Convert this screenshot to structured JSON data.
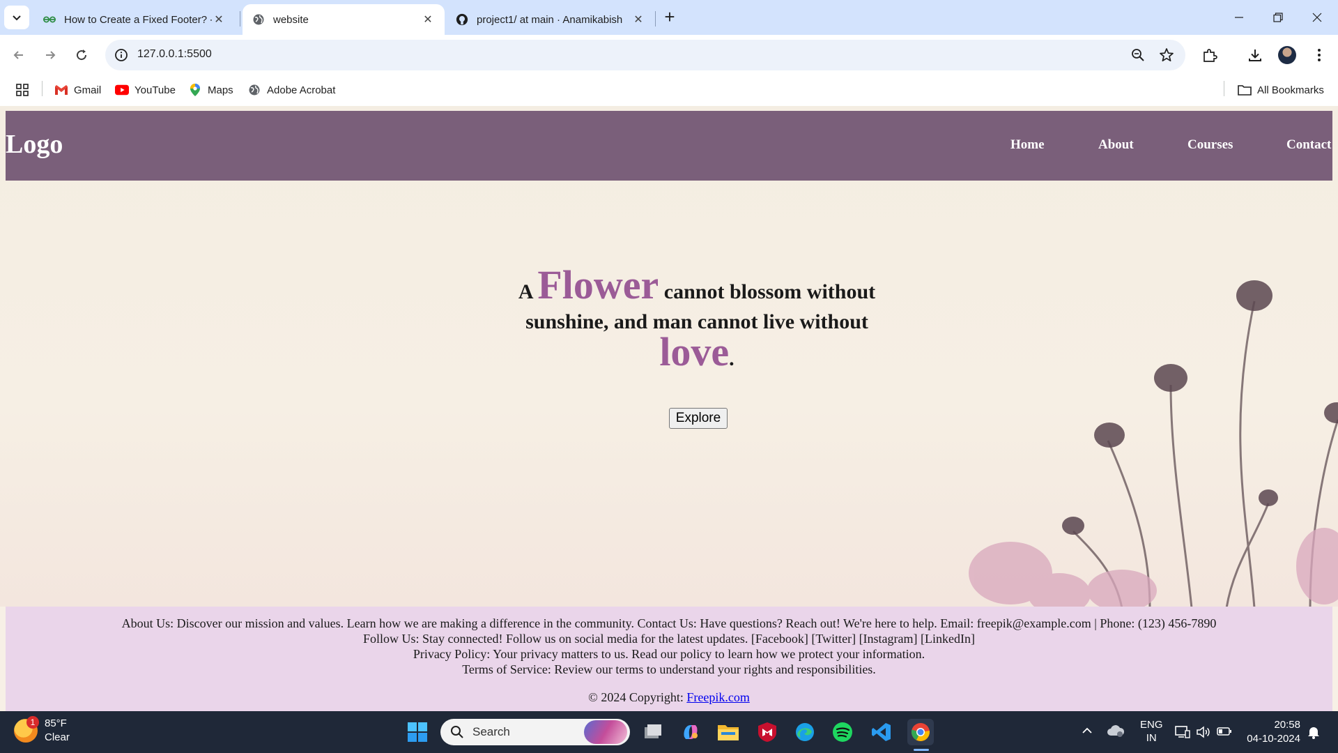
{
  "browser": {
    "tabs": [
      {
        "title": "How to Create a Fixed Footer? -",
        "active": false
      },
      {
        "title": "website",
        "active": true
      },
      {
        "title": "project1/ at main · Anamikabish",
        "active": false
      }
    ],
    "url": "127.0.0.1:5500",
    "bookmarks": [
      "Gmail",
      "YouTube",
      "Maps",
      "Adobe Acrobat"
    ],
    "all_bookmarks_label": "All Bookmarks"
  },
  "site": {
    "logo": "Logo",
    "nav": [
      "Home",
      "About",
      "Courses",
      "Contact"
    ],
    "hero": {
      "quote_a": "A",
      "quote_flower": "Flower",
      "quote_mid": "cannot blossom without sunshine, and man cannot live without",
      "quote_love": "love",
      "quote_end": ".",
      "button": "Explore"
    },
    "footer": {
      "line1": "About Us: Discover our mission and values. Learn how we are making a difference in the community. Contact Us: Have questions? Reach out! We're here to help. Email: freepik@example.com | Phone: (123) 456-7890",
      "line2": "Follow Us: Stay connected! Follow us on social media for the latest updates. [Facebook] [Twitter] [Instagram] [LinkedIn]",
      "line3": "Privacy Policy: Your privacy matters to us. Read our policy to learn how we protect your information.",
      "line4": "Terms of Service: Review our terms to understand your rights and responsibilities.",
      "copyright": "© 2024 Copyright:",
      "copyright_link": "Freepik.com"
    },
    "colors": {
      "nav_bg": "#7a5f7a",
      "accent": "#9b5b97",
      "footer_bg": "#ead5ea"
    }
  },
  "taskbar": {
    "weather_temp": "85°F",
    "weather_cond": "Clear",
    "weather_badge": "1",
    "search_placeholder": "Search",
    "lang": "ENG",
    "region": "IN",
    "time": "20:58",
    "date": "04-10-2024"
  }
}
